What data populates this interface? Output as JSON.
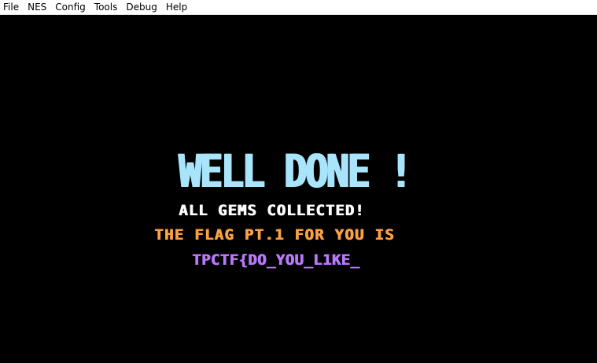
{
  "menubar": {
    "items": [
      {
        "label": "File"
      },
      {
        "label": "NES"
      },
      {
        "label": "Config"
      },
      {
        "label": "Tools"
      },
      {
        "label": "Debug"
      },
      {
        "label": "Help"
      }
    ]
  },
  "screen": {
    "title": "WELL DONE !",
    "subtitle": "ALL GEMS COLLECTED!",
    "flag_line": "THE FLAG PT.1 FOR YOU IS",
    "flag_text": "TPCTF{DO_YOU_L1KE_"
  },
  "colors": {
    "background": "#000000",
    "menubar_bg": "#ffffff",
    "title": "#a8e4fc",
    "subtitle": "#fcfcfc",
    "flag_line": "#fca044",
    "flag_text": "#b878f8"
  }
}
